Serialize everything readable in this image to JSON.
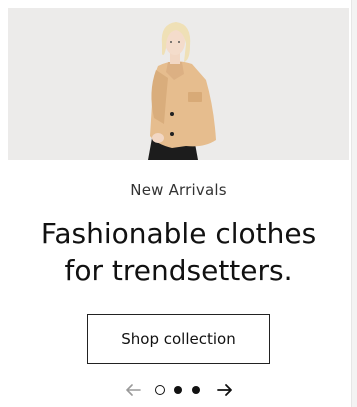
{
  "hero": {
    "image_alt": "Model wearing a camel cropped jacket",
    "background_color": "#ecebea",
    "jacket_color": "#e6bd8e",
    "hair_color": "#efe0b6"
  },
  "slide": {
    "eyebrow": "New Arrivals",
    "headline_line1": "Fashionable clothes",
    "headline_line2": "for trendsetters.",
    "cta_label": "Shop collection"
  },
  "carousel": {
    "prev_icon": "arrow-left-icon",
    "next_icon": "arrow-right-icon",
    "slide_count": 3,
    "active_index": 1
  }
}
